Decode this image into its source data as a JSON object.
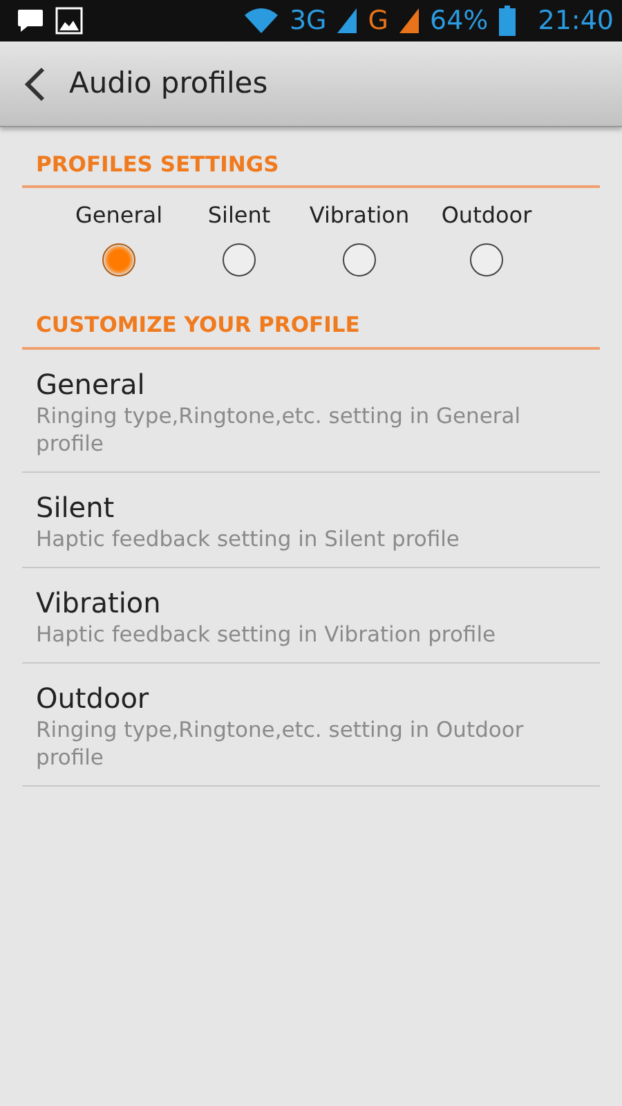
{
  "status_bar": {
    "network_3g": "3G",
    "network_g": "G",
    "battery": "64%",
    "time": "21:40"
  },
  "title": "Audio profiles",
  "profiles_settings": {
    "header": "PROFILES SETTINGS",
    "options": [
      {
        "label": "General",
        "selected": true
      },
      {
        "label": "Silent",
        "selected": false
      },
      {
        "label": "Vibration",
        "selected": false
      },
      {
        "label": "Outdoor",
        "selected": false
      }
    ]
  },
  "customize": {
    "header": "CUSTOMIZE YOUR PROFILE",
    "items": [
      {
        "title": "General",
        "subtitle": "Ringing type,Ringtone,etc. setting in General profile"
      },
      {
        "title": "Silent",
        "subtitle": "Haptic feedback setting in Silent profile"
      },
      {
        "title": "Vibration",
        "subtitle": "Haptic feedback setting in Vibration profile"
      },
      {
        "title": "Outdoor",
        "subtitle": "Ringing type,Ringtone,etc. setting in Outdoor profile"
      }
    ]
  }
}
